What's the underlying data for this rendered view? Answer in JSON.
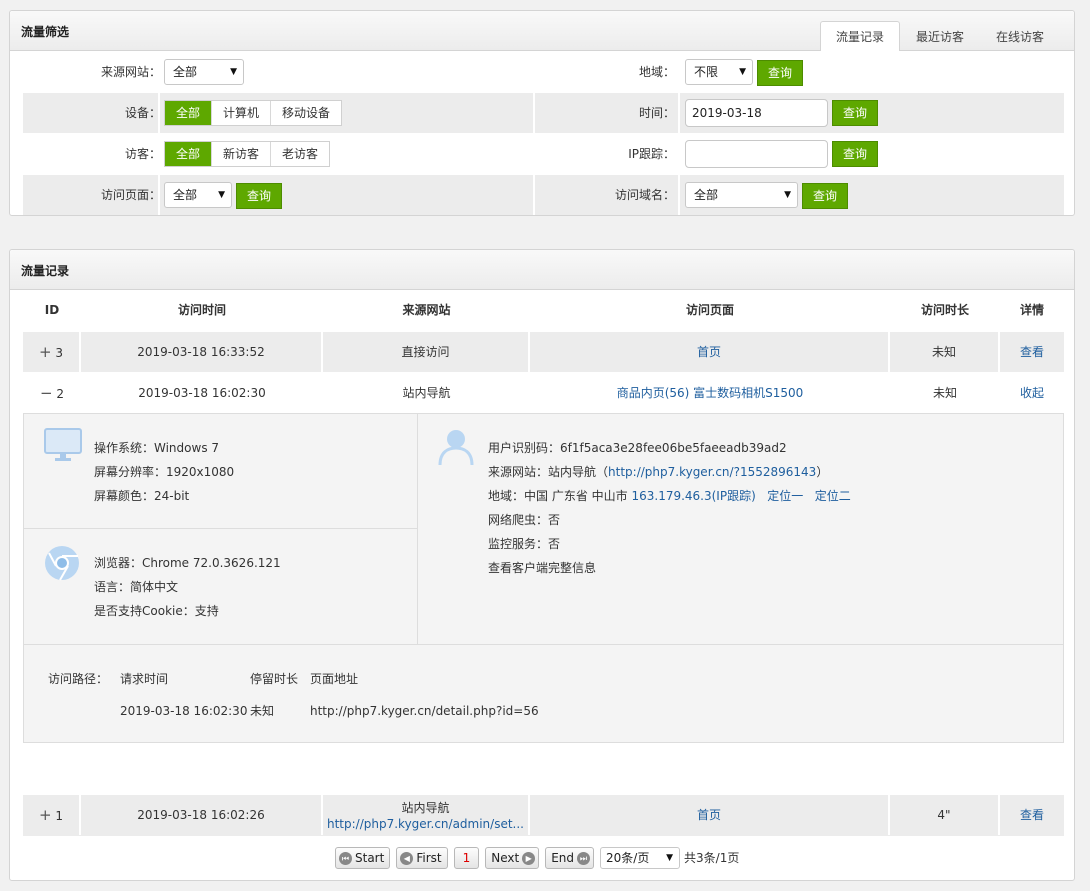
{
  "filter_panel": {
    "title": "流量筛选",
    "tabs": [
      "流量记录",
      "最近访客",
      "在线访客"
    ],
    "source_site": {
      "label": "来源网站：",
      "value": "全部"
    },
    "region": {
      "label": "地域：",
      "value": "不限",
      "button": "查询"
    },
    "device": {
      "label": "设备：",
      "options": [
        "全部",
        "计算机",
        "移动设备"
      ]
    },
    "time": {
      "label": "时间：",
      "value": "2019-03-18",
      "button": "查询"
    },
    "visitor": {
      "label": "访客：",
      "options": [
        "全部",
        "新访客",
        "老访客"
      ]
    },
    "ip": {
      "label": "IP跟踪：",
      "value": "",
      "button": "查询"
    },
    "page": {
      "label": "访问页面：",
      "value": "全部",
      "button": "查询"
    },
    "domain": {
      "label": "访问域名：",
      "value": "全部",
      "button": "查询"
    }
  },
  "records_panel": {
    "title": "流量记录",
    "headers": [
      "ID",
      "访问时间",
      "来源网站",
      "访问页面",
      "访问时长",
      "详情"
    ],
    "rows": [
      {
        "id": "3",
        "toggle": "+",
        "time": "2019-03-18 16:33:52",
        "source": "直接访问",
        "page": "首页",
        "duration": "未知",
        "action": "查看"
      },
      {
        "id": "2",
        "toggle": "−",
        "time": "2019-03-18 16:02:30",
        "source": "站内导航",
        "page": "商品内页(56) 富士数码相机S1500",
        "duration": "未知",
        "action": "收起"
      },
      {
        "id": "1",
        "toggle": "+",
        "time": "2019-03-18 16:02:26",
        "source": "站内导航",
        "source_url": "http://php7.kyger.cn/admin/set...",
        "page": "首页",
        "duration": "4\"",
        "action": "查看"
      }
    ],
    "detail": {
      "os": "操作系统：Windows 7",
      "resolution": "屏幕分辨率：1920x1080",
      "color": "屏幕颜色：24-bit",
      "browser": "浏览器：Chrome 72.0.3626.121",
      "language": "语言：简体中文",
      "cookie": "是否支持Cookie：支持",
      "user_id": "用户识别码：6f1f5aca3e28fee06be5faeeadb39ad2",
      "source_prefix": "来源网站：站内导航（",
      "source_url": "http://php7.kyger.cn/?1552896143",
      "source_suffix": "）",
      "region_prefix": "地域：中国 广东省 中山市",
      "region_ip": "163.179.46.3(IP跟踪)",
      "locate1": "定位一",
      "locate2": "定位二",
      "crawler": "网络爬虫：否",
      "monitor": "监控服务：否",
      "full_info": "查看客户端完整信息",
      "path_label": "访问路径：",
      "path_headers": [
        "请求时间",
        "停留时长",
        "页面地址"
      ],
      "path_rows": [
        {
          "time": "2019-03-18 16:02:30",
          "stay": "未知",
          "url": "http://php7.kyger.cn/detail.php?id=56"
        }
      ]
    },
    "pager": {
      "start": "Start",
      "first": "First",
      "current": "1",
      "next": "Next",
      "end": "End",
      "per_page": "20条/页",
      "summary": "共3条/1页"
    }
  }
}
